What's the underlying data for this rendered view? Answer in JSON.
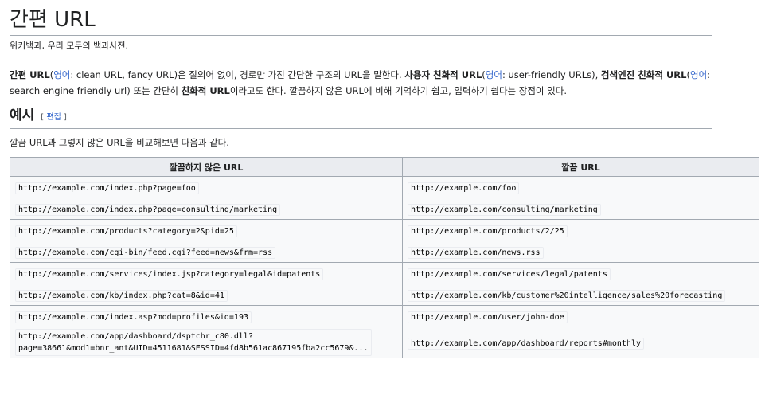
{
  "title": "간편 URL",
  "tagline": "위키백과, 우리 모두의 백과사전.",
  "lead": {
    "b1": "간편 URL",
    "lang1": "영어",
    "t1": ": clean URL, fancy URL)은 질의어 없이, 경로만 가진 간단한 구조의 URL을 말한다. ",
    "b2": "사용자 친화적 URL",
    "lang2": "영어",
    "t2": ": user-friendly URLs), ",
    "b3": "검색엔진 친화적 URL",
    "lang3": "영어",
    "t3": ": search engine friendly url) 또는 간단히 ",
    "b4": "친화적 URL",
    "t4": "이라고도 한다. 깔끔하지 않은 URL에 비해 기억하기 쉽고, 입력하기 쉽다는 장점이 있다."
  },
  "section": {
    "heading": "예시",
    "edit_label": "편집",
    "intro": "깔끔 URL과 그렇지 않은 URL을 비교해보면 다음과 같다."
  },
  "table": {
    "headers": [
      "깔끔하지 않은 URL",
      "깔끔 URL"
    ],
    "rows": [
      [
        "http://example.com/index.php?page=foo",
        "http://example.com/foo"
      ],
      [
        "http://example.com/index.php?page=consulting/marketing",
        "http://example.com/consulting/marketing"
      ],
      [
        "http://example.com/products?category=2&pid=25",
        "http://example.com/products/2/25"
      ],
      [
        "http://example.com/cgi-bin/feed.cgi?feed=news&frm=rss",
        "http://example.com/news.rss"
      ],
      [
        "http://example.com/services/index.jsp?category=legal&id=patents",
        "http://example.com/services/legal/patents"
      ],
      [
        "http://example.com/kb/index.php?cat=8&id=41",
        "http://example.com/kb/customer%20intelligence/sales%20forecasting"
      ],
      [
        "http://example.com/index.asp?mod=profiles&id=193",
        "http://example.com/user/john-doe"
      ],
      [
        "http://example.com/app/dashboard/dsptchr_c80.dll?\npage=38661&mod1=bnr_ant&UID=4511681&SESSID=4fd8b561ac867195fba2cc5679&...",
        "http://example.com/app/dashboard/reports#monthly"
      ]
    ]
  }
}
